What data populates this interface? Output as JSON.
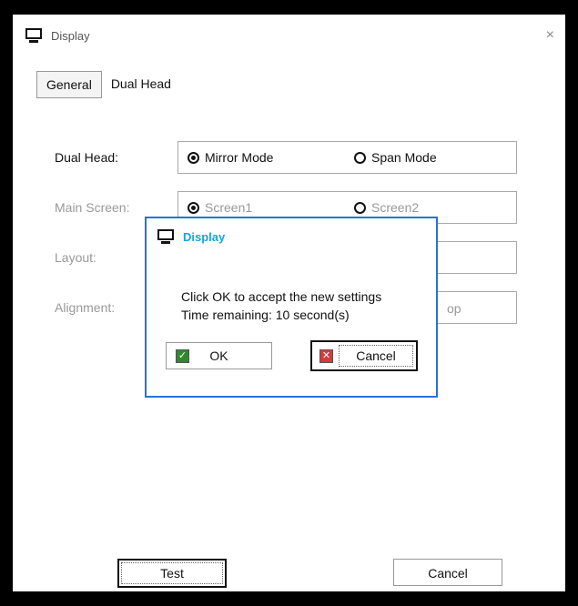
{
  "window": {
    "title": "Display",
    "close_glyph": "×",
    "icon": "monitor-icon"
  },
  "tabs": [
    {
      "label": "General",
      "active": true
    },
    {
      "label": "Dual Head",
      "active": false
    }
  ],
  "rows": {
    "dual_head": {
      "label": "Dual Head:",
      "opt1": "Mirror Mode",
      "opt2": "Span Mode",
      "selected": "Mirror Mode"
    },
    "main_screen": {
      "label": "Main Screen:",
      "opt1": "Screen1",
      "opt2": "Screen2",
      "selected": "Screen1"
    },
    "layout": {
      "label": "Layout:"
    },
    "alignment": {
      "label": "Alignment:",
      "value_fragment": "op"
    }
  },
  "buttons": {
    "test": "Test",
    "cancel": "Cancel"
  },
  "dialog": {
    "title": "Display",
    "line1": "Click OK to accept the new settings",
    "line2": "Time remaining: 10 second(s)",
    "ok": "OK",
    "cancel": "Cancel"
  }
}
